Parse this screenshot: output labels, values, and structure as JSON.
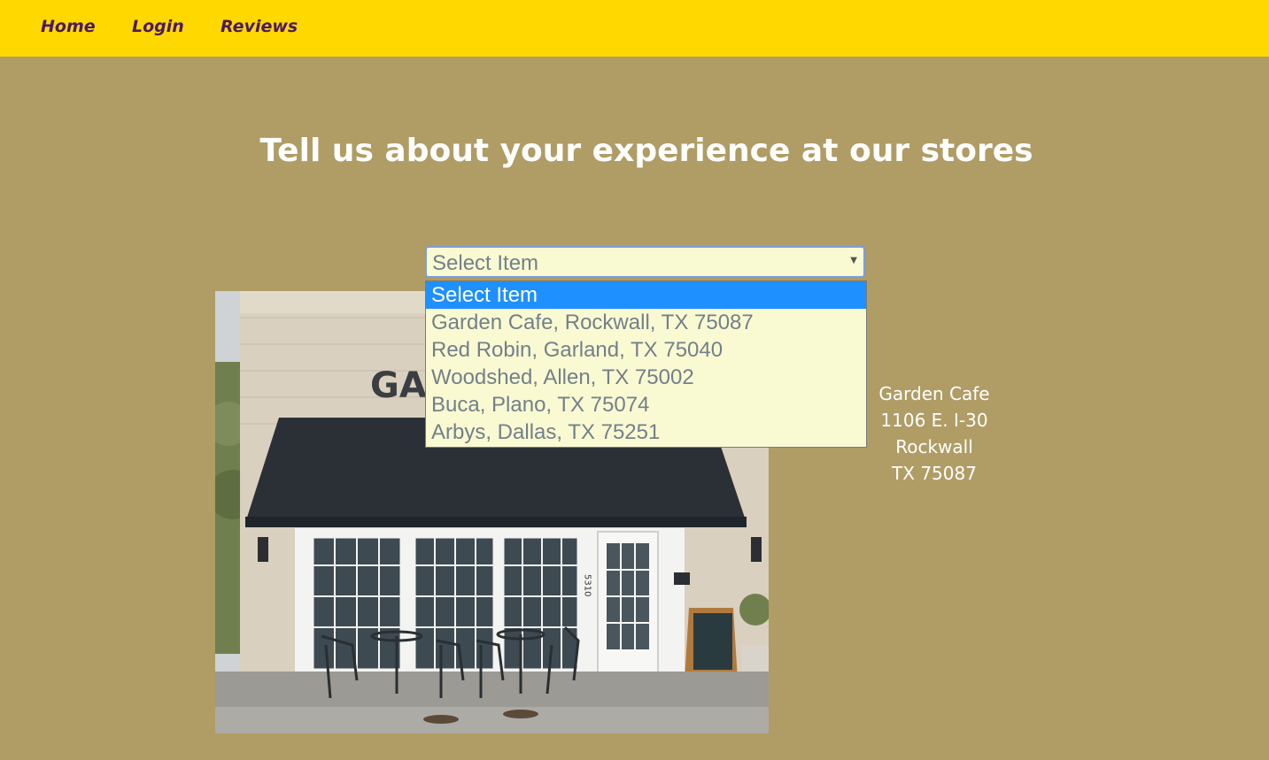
{
  "nav": {
    "items": [
      {
        "label": "Home"
      },
      {
        "label": "Login"
      },
      {
        "label": "Reviews"
      }
    ]
  },
  "heading": "Tell us about your experience at our stores",
  "store_select": {
    "selected_value": "Select Item",
    "options": [
      "Select Item",
      "Garden Cafe, Rockwall, TX 75087",
      "Red Robin, Garland, TX 75040",
      "Woodshed, Allen, TX 75002",
      "Buca, Plano, TX 75074",
      "Arbys, Dallas, TX 75251"
    ],
    "highlighted_index": 0
  },
  "store_photo": {
    "sign_text": "GA",
    "door_number": "5310"
  },
  "address": {
    "name": "Garden Cafe",
    "street": "1106 E. I-30",
    "city": "Rockwall",
    "state_zip": "TX 75087"
  },
  "colors": {
    "navbar_bg": "#ffd800",
    "nav_text": "#4b1a63",
    "page_bg": "#b09c65",
    "select_bg": "#fafad2",
    "option_highlight": "#1e90ff"
  }
}
